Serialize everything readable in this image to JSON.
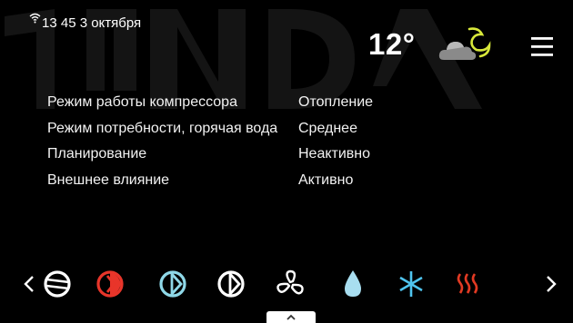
{
  "status": {
    "time_date": "13 45 3 октября"
  },
  "weather": {
    "temperature": "12°",
    "icon": "partly-cloudy-night-icon"
  },
  "menu": {
    "icon": "hamburger-menu-icon"
  },
  "info": {
    "rows": [
      {
        "label": "Режим работы компрессора",
        "value": "Отопление"
      },
      {
        "label": "Режим потребности, горячая вода",
        "value": "Среднее"
      },
      {
        "label": "Планирование",
        "value": "Неактивно"
      },
      {
        "label": "Внешнее влияние",
        "value": "Активно"
      }
    ]
  },
  "icon_strip": {
    "icons": [
      "compressor-icon",
      "heating-icon",
      "cooling-circle-icon",
      "circulation-icon",
      "fan-icon",
      "water-drop-icon",
      "snowflake-icon",
      "hot-water-icon"
    ],
    "colors": {
      "white": "#ffffff",
      "heating": "#e8352a",
      "cooling": "#8fd8e8",
      "water": "#a8def0",
      "snow": "#4fc4ee",
      "hot": "#e23a23"
    }
  },
  "watermark_color": "#151515"
}
